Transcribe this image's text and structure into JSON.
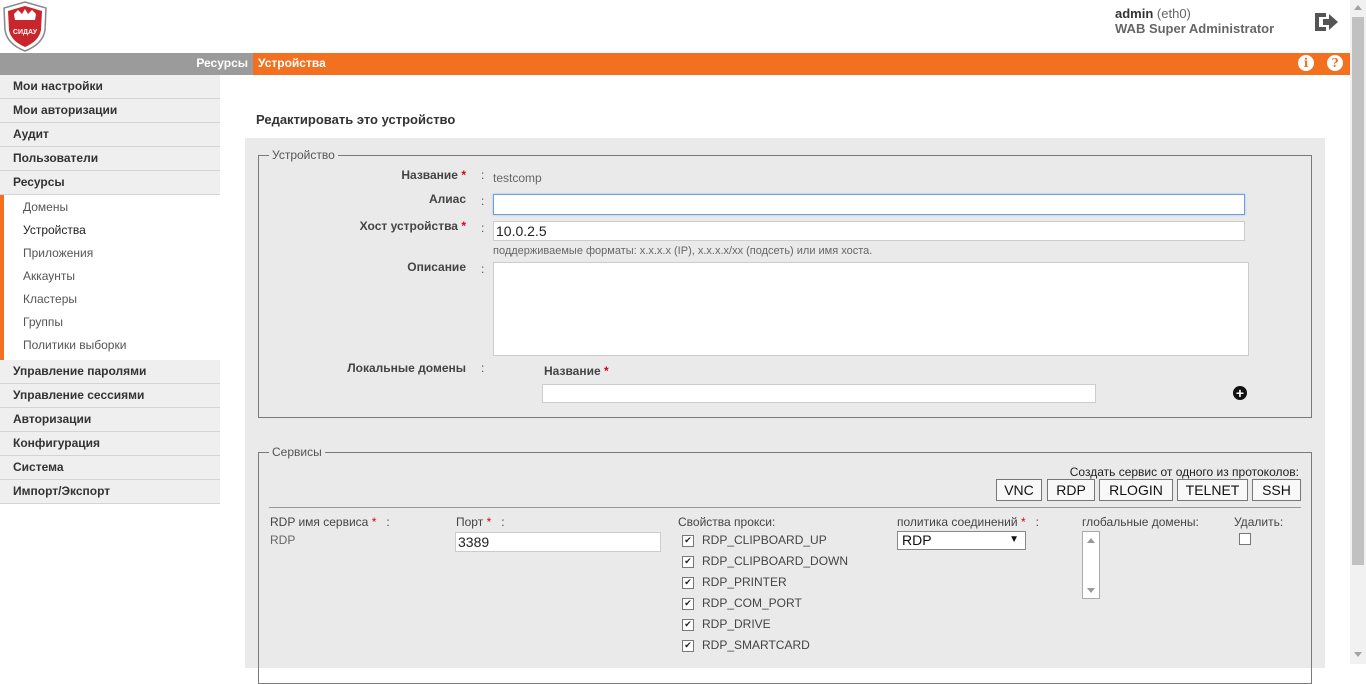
{
  "header": {
    "user_name": "admin",
    "user_iface": "(eth0)",
    "user_role": "WAB Super Administrator",
    "logo_text": "СИДАУ"
  },
  "breadcrumb": {
    "parent": "Ресурсы",
    "current": "Устройства",
    "info_icon": "i",
    "help_icon": "?"
  },
  "sidebar": {
    "items_top": [
      "Мои настройки",
      "Мои авторизации",
      "Аудит",
      "Пользователи",
      "Ресурсы"
    ],
    "sub_items": [
      "Домены",
      "Устройства",
      "Приложения",
      "Аккаунты",
      "Кластеры",
      "Группы",
      "Политики выборки"
    ],
    "active_sub": "Устройства",
    "items_bottom": [
      "Управление паролями",
      "Управление сессиями",
      "Авторизации",
      "Конфигурация",
      "Система",
      "Импорт/Экспорт"
    ]
  },
  "page": {
    "title": "Редактировать это устройство"
  },
  "device": {
    "legend": "Устройство",
    "name_label": "Название",
    "name_value": "testcomp",
    "alias_label": "Алиас",
    "alias_value": "",
    "host_label": "Хост устройства",
    "host_value": "10.0.2.5",
    "host_hint": "поддерживаемые форматы: x.x.x.x (IP), x.x.x.x/xx (подсеть) или имя хоста.",
    "desc_label": "Описание",
    "desc_value": "",
    "local_domains_label": "Локальные домены",
    "local_domain_name_label": "Название",
    "local_domain_value": "",
    "required_mark": "*",
    "colon": ":"
  },
  "services": {
    "legend": "Сервисы",
    "create_label": "Создать сервис от одного из протоколов:",
    "protocols": [
      "VNC",
      "RDP",
      "RLOGIN",
      "TELNET",
      "SSH"
    ],
    "service_name_label": "RDP имя сервиса",
    "service_name_value": "RDP",
    "port_label": "Порт",
    "port_value": "3389",
    "proxy_label": "Свойства прокси:",
    "proxy_options": [
      "RDP_CLIPBOARD_UP",
      "RDP_CLIPBOARD_DOWN",
      "RDP_PRINTER",
      "RDP_COM_PORT",
      "RDP_DRIVE",
      "RDP_SMARTCARD"
    ],
    "policy_label": "политика соединений",
    "policy_value": "RDP",
    "global_domains_label": "глобальные домены:",
    "delete_label": "Удалить:"
  },
  "colors": {
    "accent": "#f37021",
    "crumb_grey": "#9b9b9b",
    "panel": "#eaeaea",
    "required": "#d9001b"
  },
  "icons": {
    "logout": "logout-icon",
    "info": "info-icon",
    "help": "help-icon",
    "add": "plus-circle-icon",
    "dropdown": "triangle-down-icon"
  }
}
